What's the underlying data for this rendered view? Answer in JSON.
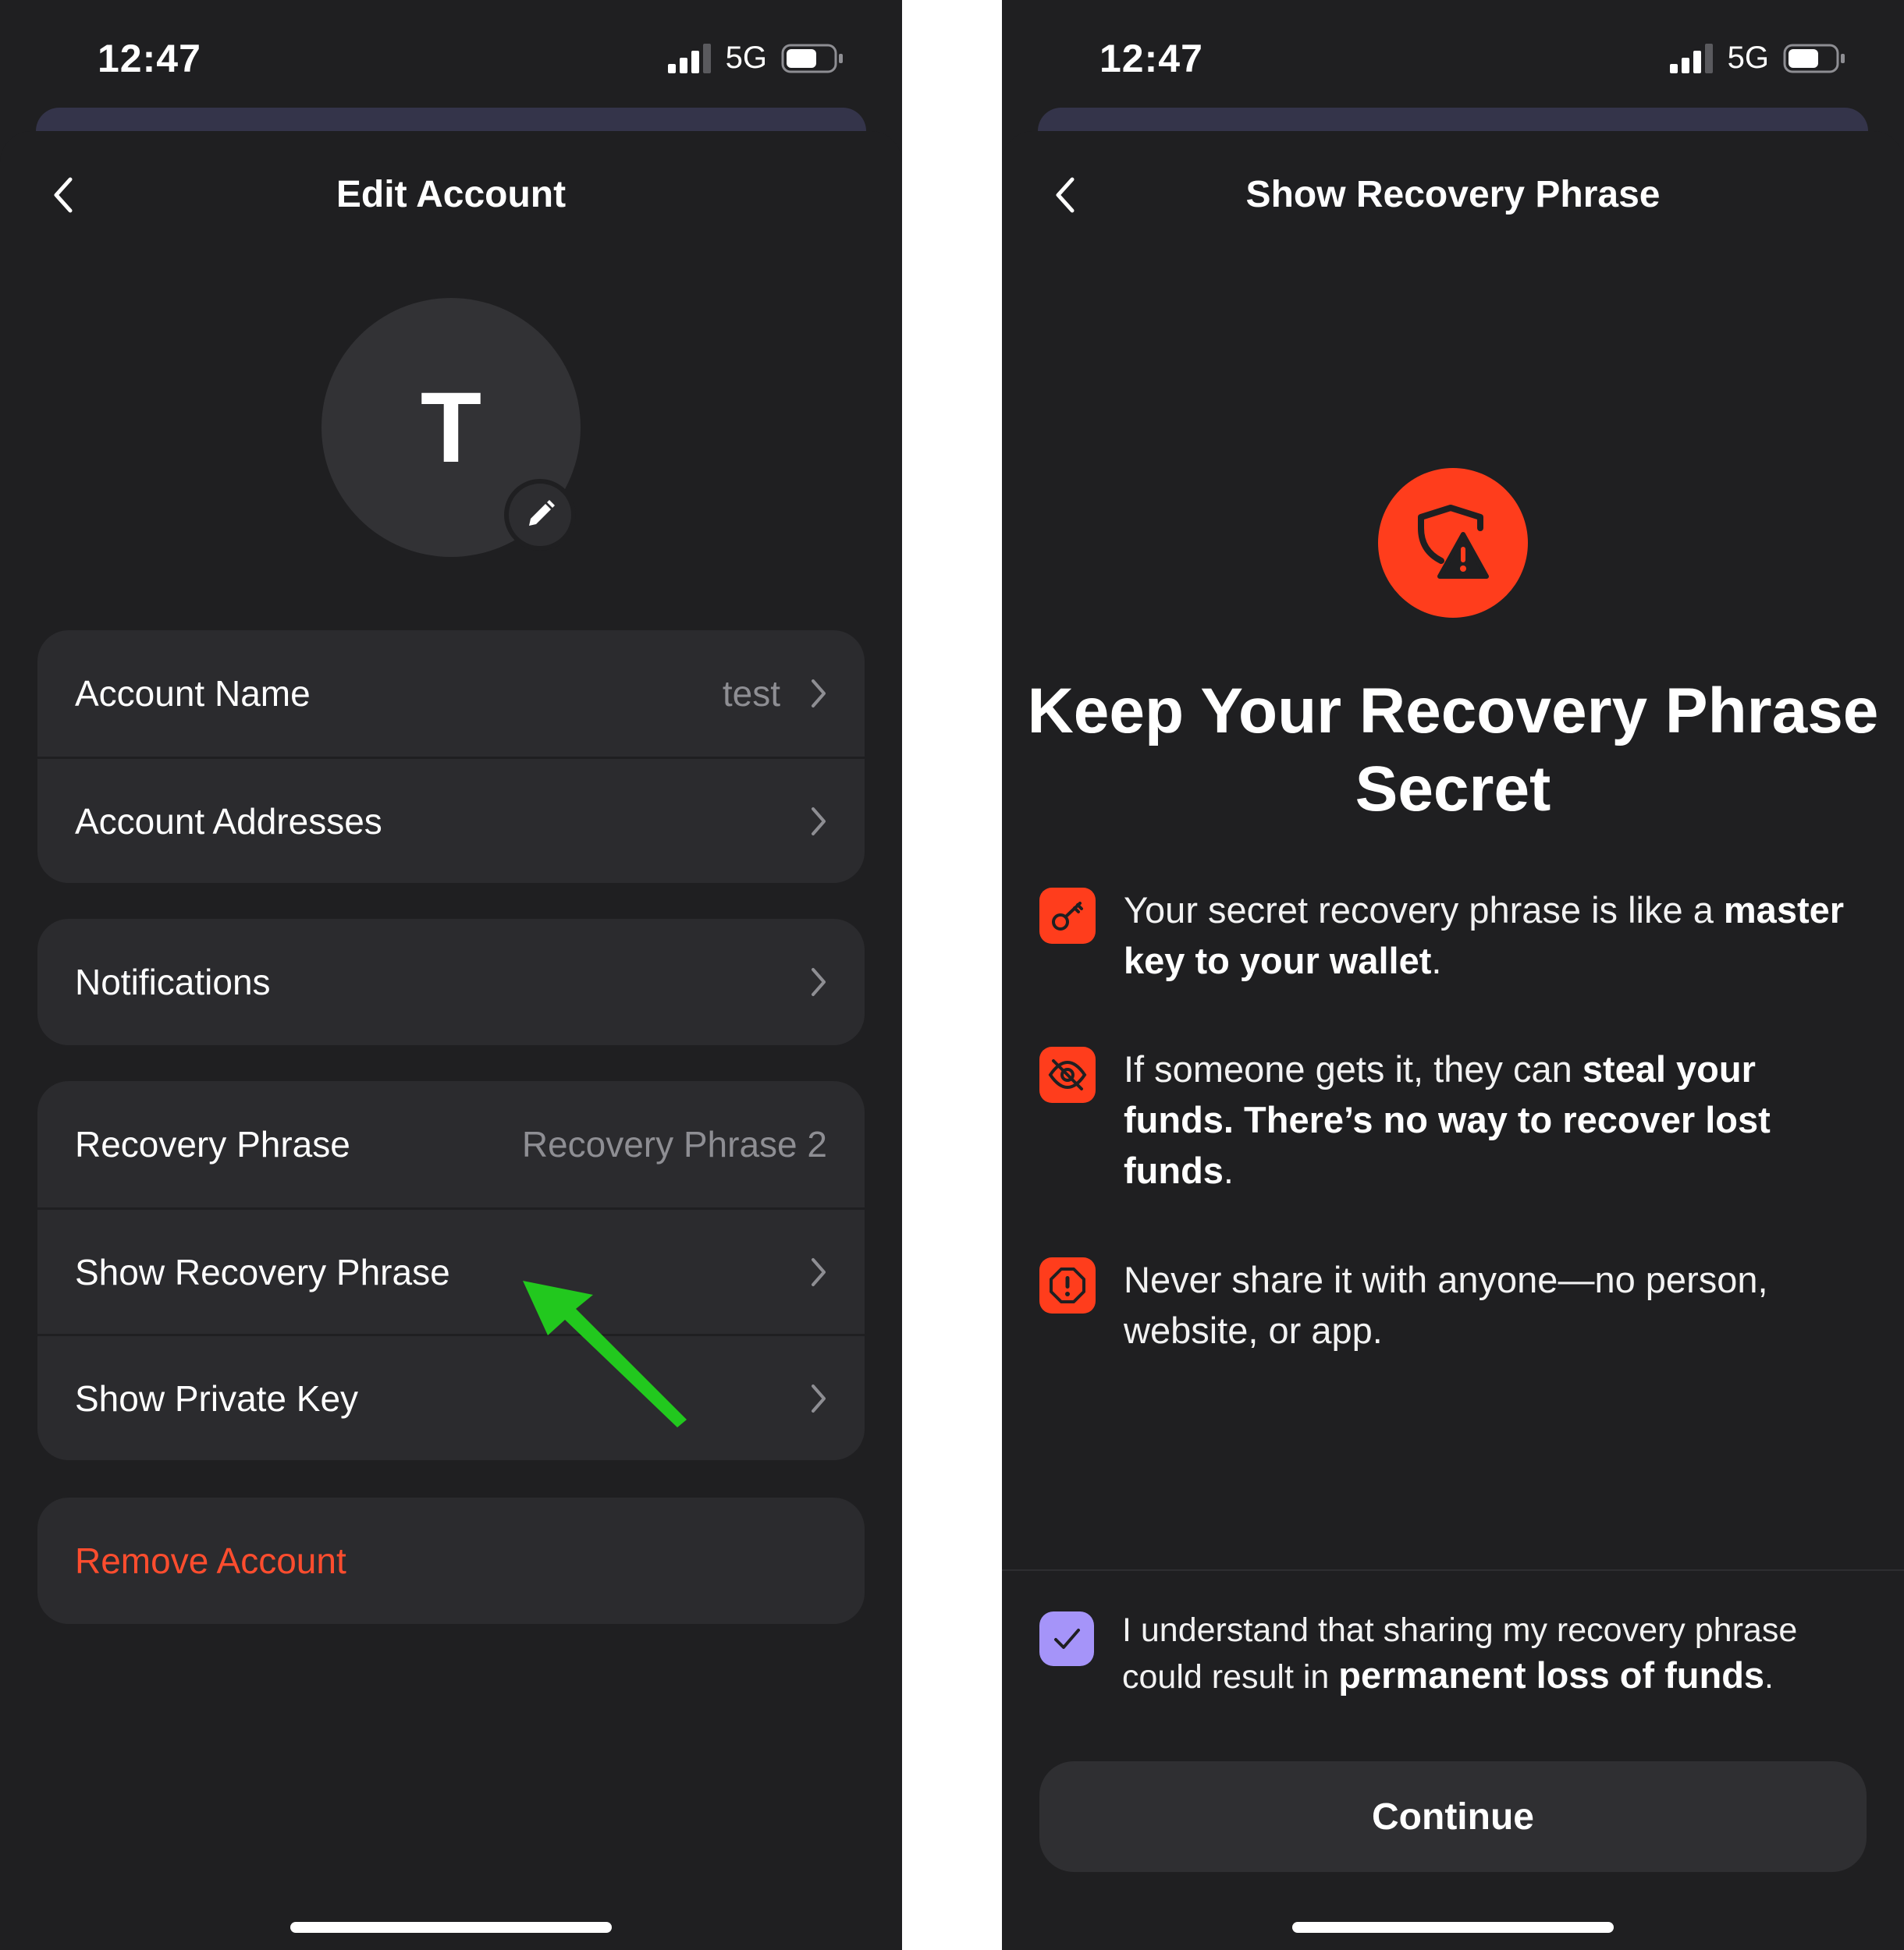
{
  "left_screen": {
    "status": {
      "time": "12:47",
      "network": "5G"
    },
    "nav": {
      "title": "Edit Account"
    },
    "avatar": {
      "initial": "T"
    },
    "rows": {
      "account_name": {
        "label": "Account Name",
        "value": "test"
      },
      "account_addresses": {
        "label": "Account Addresses"
      },
      "notifications": {
        "label": "Notifications"
      },
      "recovery_phrase": {
        "label": "Recovery Phrase",
        "value": "Recovery Phrase 2"
      },
      "show_recovery_phrase": {
        "label": "Show Recovery Phrase"
      },
      "show_private_key": {
        "label": "Show Private Key"
      },
      "remove_account": {
        "label": "Remove Account"
      }
    }
  },
  "right_screen": {
    "status": {
      "time": "12:47",
      "network": "5G"
    },
    "nav": {
      "title": "Show Recovery Phrase"
    },
    "headline": "Keep Your Recovery Phrase Secret",
    "points": [
      {
        "icon": "key-icon",
        "text": "Your secret recovery phrase is like a ",
        "bold": "master key to your wallet",
        "after": "."
      },
      {
        "icon": "eye-slash-icon",
        "text": "If someone gets it, they can ",
        "bold": "steal your funds. There’s no way to recover lost funds",
        "after": "."
      },
      {
        "icon": "alert-octagon-icon",
        "text": "Never share it with anyone—no person, website, or app.",
        "bold": "",
        "after": ""
      }
    ],
    "acknowledgement": {
      "checked": true,
      "text": "I understand that sharing my recovery phrase could result in ",
      "bold": "permanent loss of funds",
      "after": "."
    },
    "continue_label": "Continue"
  },
  "colors": {
    "background": "#1f1f21",
    "row_background": "#2b2b2e",
    "accent_red": "#ff3d1c",
    "danger_text": "#ff4d2e",
    "checkbox": "#a594f9",
    "annotation_arrow": "#22c81e"
  }
}
